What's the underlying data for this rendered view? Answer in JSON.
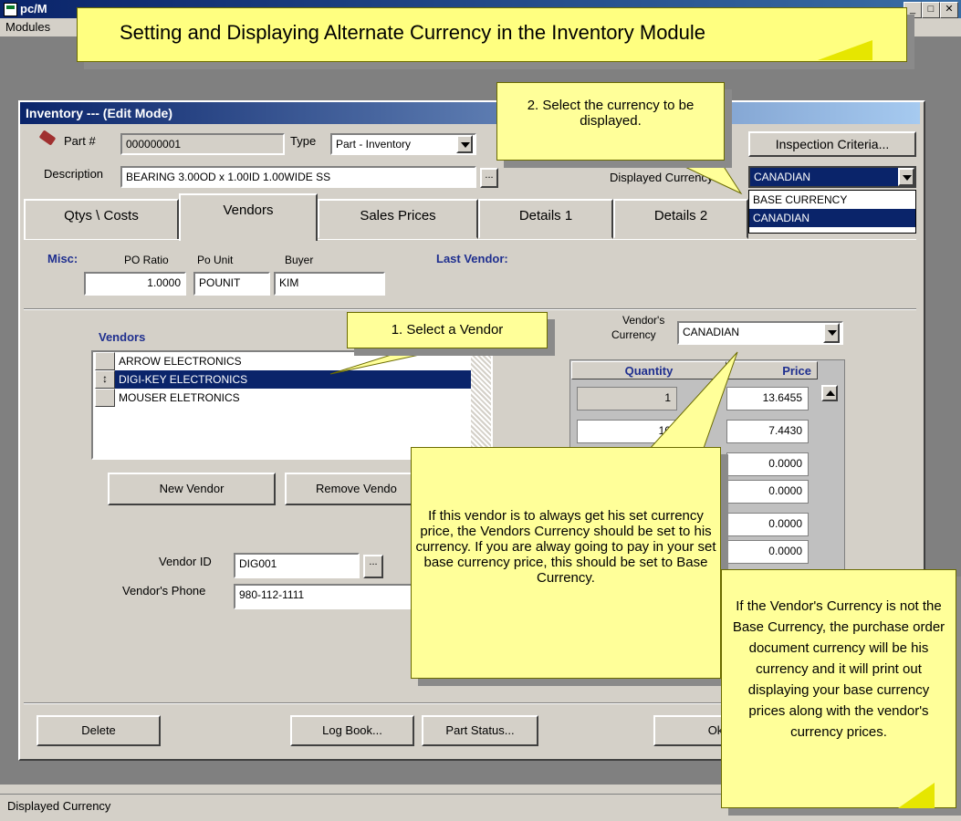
{
  "app": {
    "title": "pc/M",
    "menu_modules": "Modules",
    "status": "Displayed Currency"
  },
  "title_callout": "Setting and Displaying Alternate Currency in the Inventory Module",
  "window": {
    "title": "Inventory --- (Edit Mode)",
    "part_label": "Part #",
    "part_value": "000000001",
    "type_label": "Type",
    "type_value": "Part - Inventory",
    "description_label": "Description",
    "description_value": "BEARING 3.00OD x 1.00ID 1.00WIDE SS",
    "browse": "...",
    "inspection_button": "Inspection Criteria...",
    "displayed_currency_label": "Displayed Currency",
    "displayed_currency_value": "CANADIAN",
    "currency_options": [
      "BASE CURRENCY",
      "CANADIAN"
    ],
    "tabs": [
      "Qtys \\ Costs",
      "Vendors",
      "Sales Prices",
      "Details 1",
      "Details 2"
    ],
    "misc_label": "Misc:",
    "po_ratio_label": "PO Ratio",
    "po_ratio_value": "1.0000",
    "po_unit_label": "Po Unit",
    "po_unit_value": "POUNIT",
    "buyer_label": "Buyer",
    "buyer_value": "KIM",
    "last_vendor_label": "Last Vendor:",
    "vendors_label": "Vendors",
    "vendors": [
      "ARROW ELECTRONICS",
      "DIGI-KEY ELECTRONICS",
      "MOUSER ELETRONICS"
    ],
    "selected_marker": "↕",
    "new_vendor_button": "New Vendor",
    "remove_vendor_button": "Remove Vendo",
    "vendor_id_label": "Vendor ID",
    "vendor_id_value": "DIG001",
    "vendor_phone_label": "Vendor's Phone",
    "vendor_phone_value": "980-112-1111",
    "vendor_currency_label_1": "Vendor's",
    "vendor_currency_label_2": "Currency",
    "vendor_currency_value": "CANADIAN",
    "grid_qty_header": "Quantity",
    "grid_price_header": "Price",
    "grid_qty": [
      "1",
      "10"
    ],
    "grid_price": [
      "13.6455",
      "7.4430",
      "0.0000",
      "0.0000",
      "0.0000",
      "0.0000"
    ],
    "delete_button": "Delete",
    "log_book_button": "Log Book...",
    "part_status_button": "Part Status...",
    "ok_button": "Ok"
  },
  "callouts": {
    "select_currency": "2. Select the currency to be displayed.",
    "select_vendor": "1. Select a Vendor",
    "vendor_currency_note": "If this vendor is to always get his set currency price, the Vendors Currency should be set to his currency.  If you are alway going to pay in your set base currency price, this should be set to Base Currency.",
    "po_note": "If the Vendor's Currency is not the Base Currency, the purchase order document currency will be his currency and it will print out displaying your base currency prices along with the vendor's currency prices."
  },
  "colors": {
    "highlight": "#0a246a",
    "callout": "#ffff99",
    "label_blue": "#1f2f8f"
  }
}
